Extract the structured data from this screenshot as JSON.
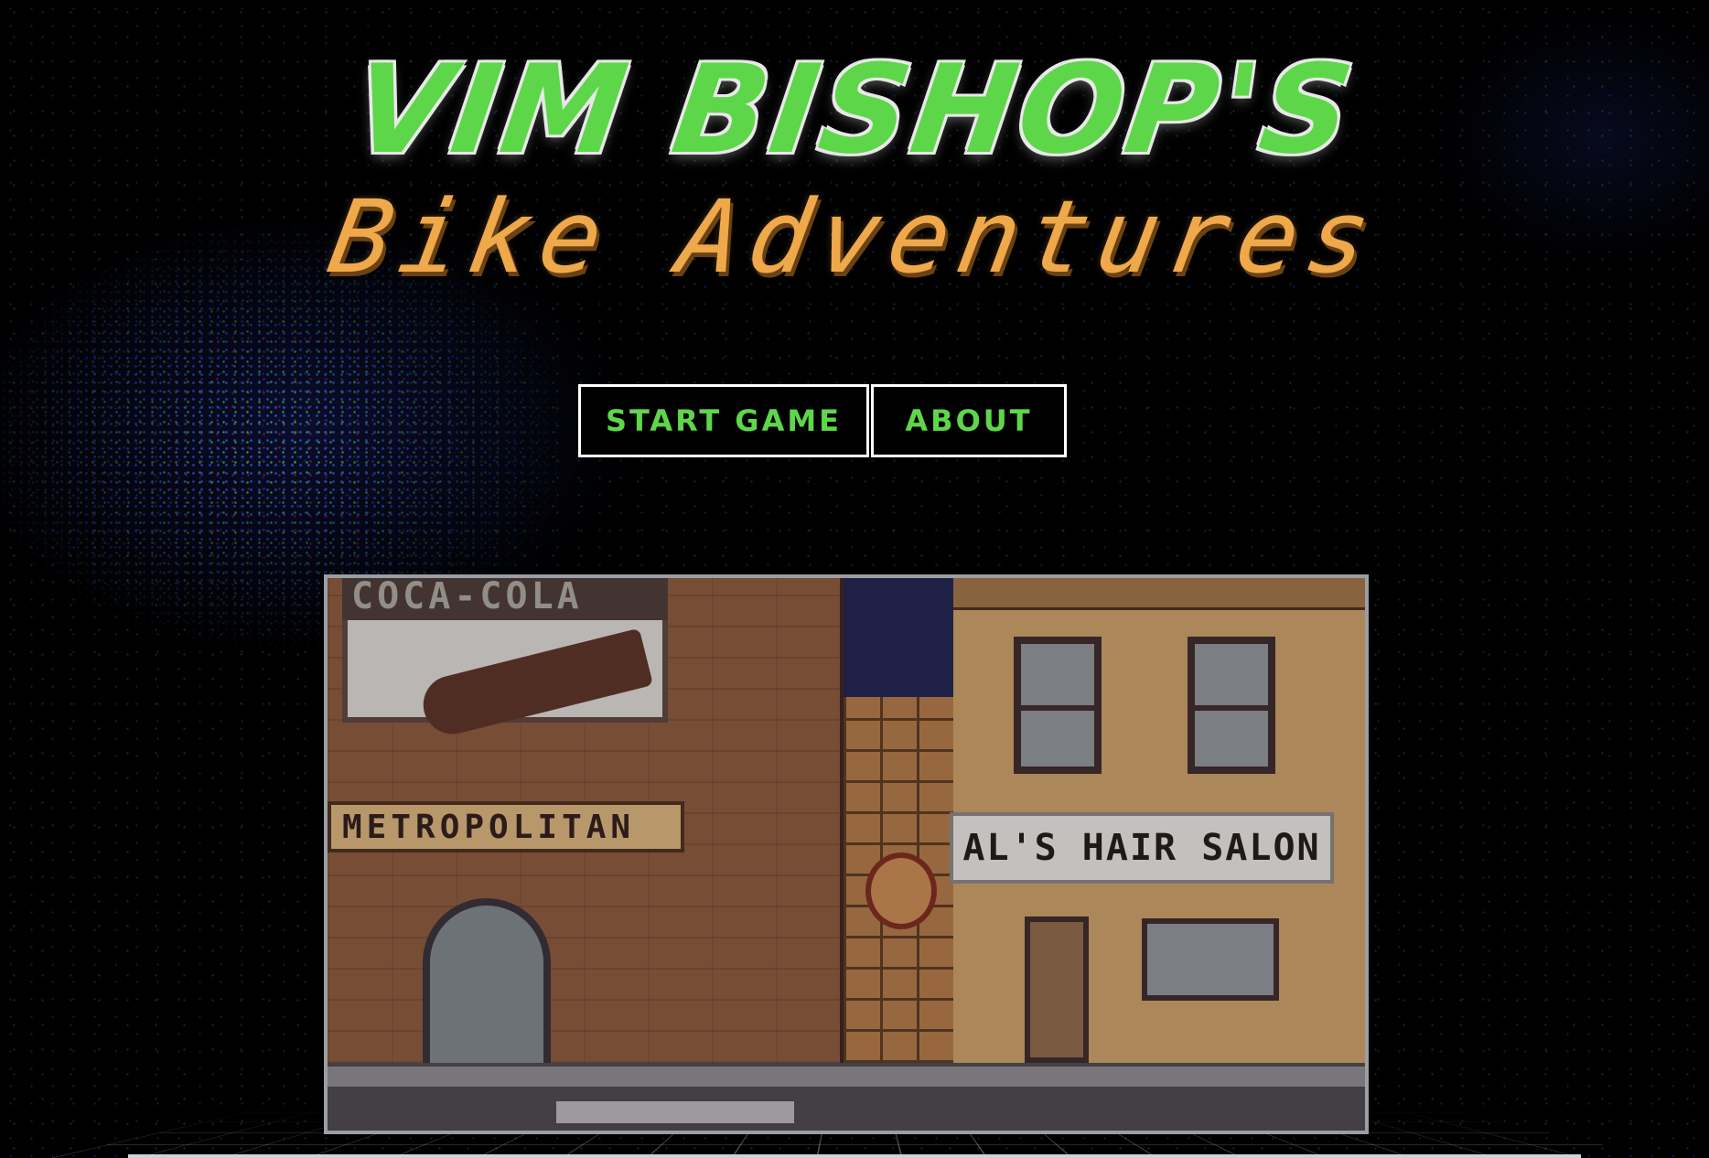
{
  "title": {
    "line1": "VIM BISHOP'S",
    "line2": "Bike Adventures"
  },
  "menu": {
    "start_label": "START GAME",
    "about_label": "ABOUT"
  },
  "preview": {
    "billboard_text": "COCA-COLA",
    "metro_sign": "METROPOLITAN",
    "salon_sign": "AL'S HAIR SALON"
  },
  "colors": {
    "title_green": "#5ed64a",
    "subtitle_orange": "#f0a94a",
    "button_border": "#ffffff",
    "background": "#000000"
  }
}
